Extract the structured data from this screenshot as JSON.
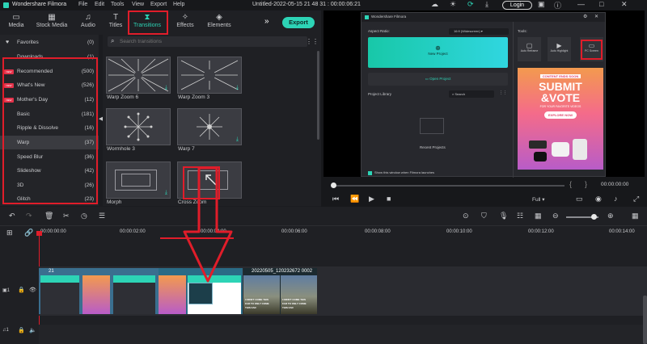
{
  "app": {
    "name": "Wondershare Filmora",
    "menu": [
      "File",
      "Edit",
      "Tools",
      "View",
      "Export",
      "Help"
    ],
    "project_title": "Untitled-2022-05-15 21 48 31 : 00:00:06:21",
    "login_label": "Login"
  },
  "toolbar": {
    "tabs": [
      {
        "label": "Media",
        "icon": "folder-icon"
      },
      {
        "label": "Stock Media",
        "icon": "stock-media-icon"
      },
      {
        "label": "Audio",
        "icon": "music-note-icon"
      },
      {
        "label": "Titles",
        "icon": "text-icon"
      },
      {
        "label": "Transitions",
        "icon": "transitions-icon",
        "active": true
      },
      {
        "label": "Effects",
        "icon": "effects-icon"
      },
      {
        "label": "Elements",
        "icon": "elements-icon"
      }
    ],
    "export_label": "Export",
    "accent": "#2dd4b6"
  },
  "sidebar": {
    "items": [
      {
        "label": "Favorites",
        "count": "(0)"
      },
      {
        "label": "Downloads",
        "count": "(1)"
      },
      {
        "label": "Recommended",
        "count": "(500)",
        "badge": "NEW"
      },
      {
        "label": "What's New",
        "count": "(526)",
        "badge": "NEW"
      },
      {
        "label": "Mother's Day",
        "count": "(12)",
        "badge": "NEW"
      },
      {
        "label": "Basic",
        "count": "(181)"
      },
      {
        "label": "Ripple & Dissolve",
        "count": "(16)"
      },
      {
        "label": "Warp",
        "count": "(37)",
        "selected": true
      },
      {
        "label": "Speed Blur",
        "count": "(36)"
      },
      {
        "label": "Slideshow",
        "count": "(42)"
      },
      {
        "label": "3D",
        "count": "(26)"
      },
      {
        "label": "Glitch",
        "count": "(23)"
      }
    ]
  },
  "search": {
    "placeholder": "Search transitions"
  },
  "transitions": [
    {
      "label": "Warp Zoom 6"
    },
    {
      "label": "Warp Zoom 3"
    },
    {
      "label": "Wormhole 3"
    },
    {
      "label": "Warp 7"
    },
    {
      "label": "Morph"
    },
    {
      "label": "Cross Zoom"
    }
  ],
  "launcher": {
    "title": "Wondershare Filmora",
    "aspect_ratio_label": "Aspect Ratio:",
    "aspect_ratio_value": "16:9 (Widescreen)",
    "new_project": "New Project",
    "open_project": "Open Project",
    "project_library": "Project Library",
    "search_placeholder": "Search",
    "recent_projects": "Recent Projects",
    "show_window": "Show this window when Filmora launches",
    "tools_label": "Tools:",
    "tools": [
      "Auto Reframe",
      "Auto Highlight",
      "PC Screen"
    ],
    "ad": {
      "top": "CONTENT ENDS SOON",
      "headline1": "SUBMIT",
      "headline2": "&VOTE",
      "sub": "FOR YOUR FAVORITE VIDEOS",
      "cta": "EXPLORE NOW"
    }
  },
  "player": {
    "time_start": "00:00:00:00",
    "time_end": "00:00:00:00",
    "quality": "Full"
  },
  "timeline": {
    "ruler": [
      "00:00:00:00",
      "00:00:02:00",
      "00:00:04:00",
      "00:00:06:00",
      "00:00:08:00",
      "00:00:10:00",
      "00:00:12:00",
      "00:00:14:00"
    ],
    "clip1_label": "21",
    "clip2_label": "20220505_120232672 0002",
    "clip_caption": [
      "I DIDN'T COME THIS",
      "FAR TO ONLY COME",
      "THIS FAR"
    ]
  }
}
